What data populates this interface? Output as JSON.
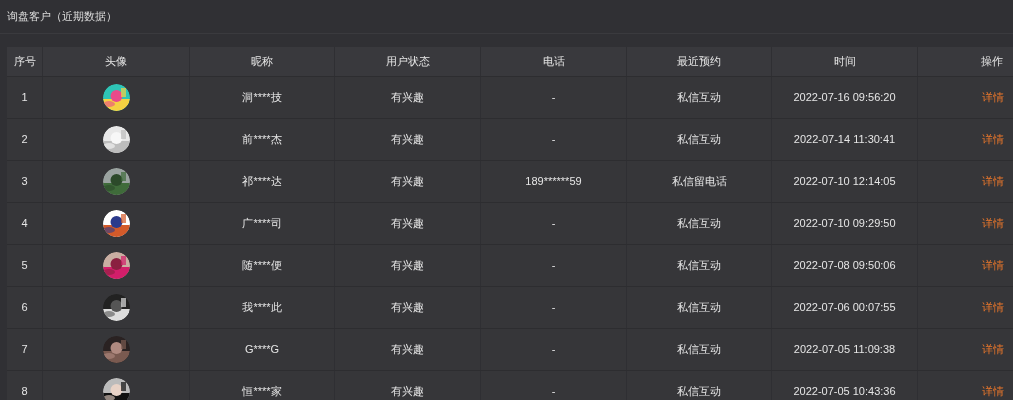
{
  "title": "询盘客户（近期数据）",
  "table": {
    "columns": [
      "序号",
      "头像",
      "昵称",
      "用户状态",
      "电话",
      "最近预约",
      "时间",
      "操作"
    ],
    "rows": [
      {
        "index": "1",
        "nickname": "洞****技",
        "status": "有兴趣",
        "phone": "-",
        "recent": "私信互动",
        "time": "2022-07-16 09:56:20",
        "action": "详情"
      },
      {
        "index": "2",
        "nickname": "前****杰",
        "status": "有兴趣",
        "phone": "-",
        "recent": "私信互动",
        "time": "2022-07-14 11:30:41",
        "action": "详情"
      },
      {
        "index": "3",
        "nickname": "祁****达",
        "status": "有兴趣",
        "phone": "189******59",
        "recent": "私信留电话",
        "time": "2022-07-10 12:14:05",
        "action": "详情"
      },
      {
        "index": "4",
        "nickname": "广****司",
        "status": "有兴趣",
        "phone": "-",
        "recent": "私信互动",
        "time": "2022-07-10 09:29:50",
        "action": "详情"
      },
      {
        "index": "5",
        "nickname": "随****便",
        "status": "有兴趣",
        "phone": "-",
        "recent": "私信互动",
        "time": "2022-07-08 09:50:06",
        "action": "详情"
      },
      {
        "index": "6",
        "nickname": "我****此",
        "status": "有兴趣",
        "phone": "-",
        "recent": "私信互动",
        "time": "2022-07-06 00:07:55",
        "action": "详情"
      },
      {
        "index": "7",
        "nickname": "G****G",
        "status": "有兴趣",
        "phone": "-",
        "recent": "私信互动",
        "time": "2022-07-05 11:09:38",
        "action": "详情"
      },
      {
        "index": "8",
        "nickname": "恒****家",
        "status": "有兴趣",
        "phone": "-",
        "recent": "私信互动",
        "time": "2022-07-05 10:43:36",
        "action": "详情"
      }
    ]
  }
}
